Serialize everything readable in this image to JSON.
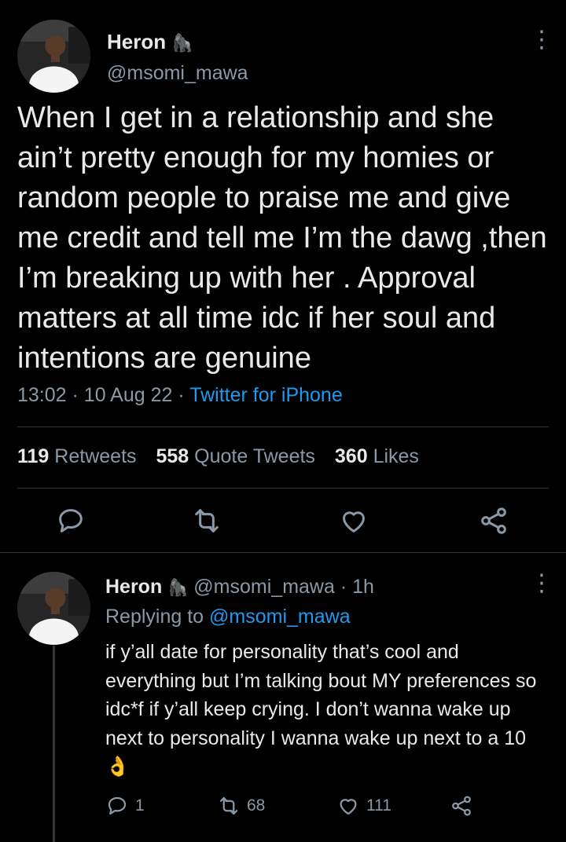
{
  "tweet": {
    "author_name": "Heron",
    "author_badge_icon": "gorilla-emoji",
    "author_handle": "@msomi_mawa",
    "text": "When I get in a relationship and she ain’t pretty enough for my homies or random people to praise me and give me credit and tell me I’m the dawg ,then I’m breaking up with her . Approval matters at all time idc if her soul and intentions are genuine",
    "time": "13:02",
    "date": "10 Aug 22",
    "source": "Twitter for iPhone",
    "separator": "·",
    "stats": {
      "retweets_count": "119",
      "retweets_label": "Retweets",
      "quotes_count": "558",
      "quotes_label": "Quote Tweets",
      "likes_count": "360",
      "likes_label": "Likes"
    },
    "actions": [
      "reply-icon",
      "retweet-icon",
      "like-icon",
      "share-icon"
    ]
  },
  "reply": {
    "author_name": "Heron",
    "author_badge_icon": "gorilla-emoji",
    "author_handle": "@msomi_mawa",
    "separator": "·",
    "age": "1h",
    "replying_prefix": "Replying to",
    "replying_to": "@msomi_mawa",
    "text": "if y’all date for personality that’s cool and everything but I’m talking bout MY preferences so idc*f if y’all keep crying. I don’t wanna wake up next to personality I wanna wake up next to a 10 👌",
    "counts": {
      "replies": "1",
      "retweets": "68",
      "likes": "111"
    }
  },
  "colors": {
    "background": "#000000",
    "text": "#e7e9ea",
    "muted": "#8b98a5",
    "link": "#1d9bf0",
    "divider": "#2f3336"
  }
}
